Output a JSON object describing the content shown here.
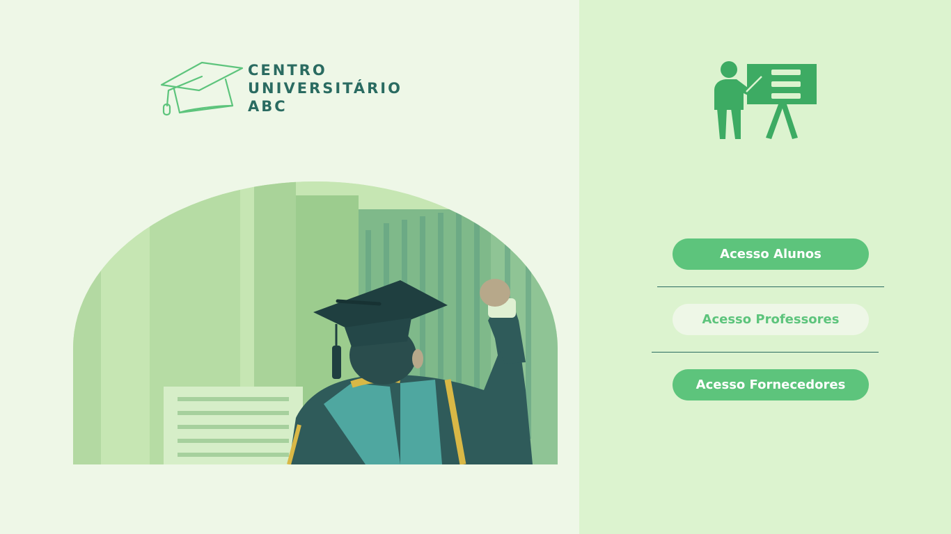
{
  "brand": {
    "line1": "CENTRO",
    "line2": "UNIVERSITÁRIO",
    "line3": "ABC"
  },
  "icons": {
    "logo": "graduation-cap-icon",
    "teacher": "teacher-board-icon"
  },
  "access": {
    "alunos_label": "Acesso Alunos",
    "professores_label": "Acesso Professores",
    "fornecedores_label": "Acesso Fornecedores"
  },
  "colors": {
    "left_background": "#eef7e7",
    "right_background": "#dcf3cf",
    "accent_green": "#5dc47c",
    "brand_teal": "#2a6b61"
  }
}
